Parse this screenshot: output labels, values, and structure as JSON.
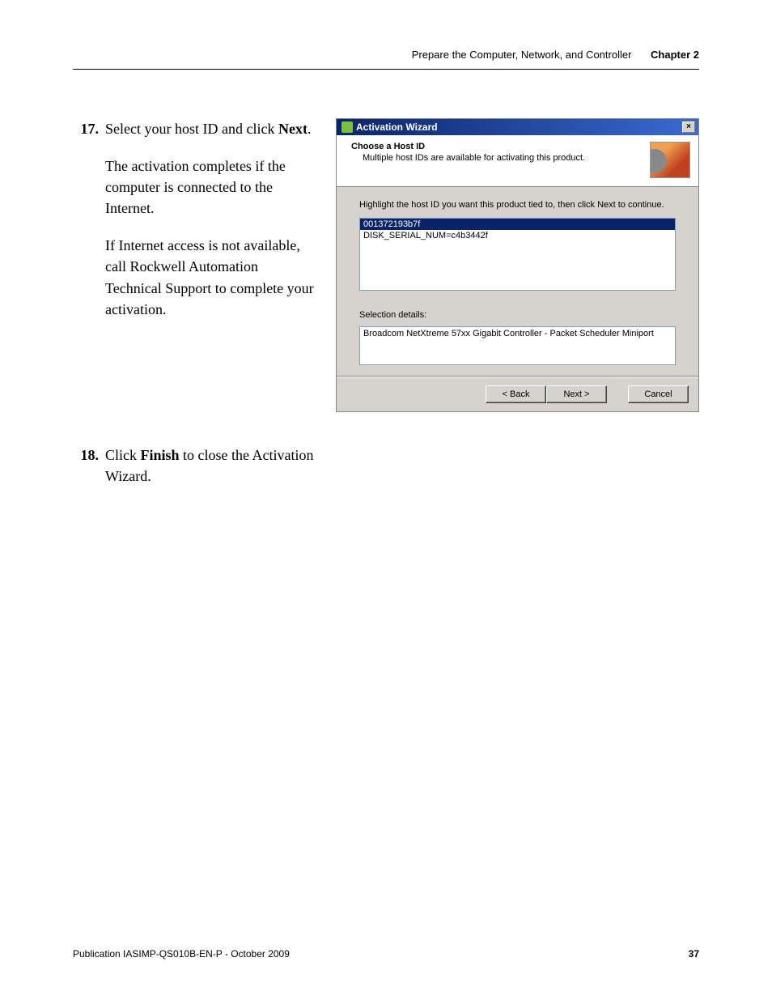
{
  "header": {
    "title": "Prepare the Computer, Network, and Controller",
    "chapter": "Chapter 2"
  },
  "step17": {
    "num": "17.",
    "line1a": "Select your host ID and click ",
    "line1b": "Next",
    "line1c": ".",
    "para2": "The activation completes if the computer is connected to the Internet.",
    "para3": "If Internet access is not available, call Rockwell Automation Technical Support to complete your activation."
  },
  "step18": {
    "num": "18.",
    "line1a": "Click ",
    "line1b": "Finish",
    "line1c": " to close the Activation Wizard."
  },
  "wizard": {
    "title": "Activation Wizard",
    "close": "×",
    "header_title": "Choose a Host ID",
    "header_sub": "Multiple host IDs are available for activating this product.",
    "instruction": "Highlight the host ID you want this product tied to, then click Next to continue.",
    "host_ids": {
      "item0": "001372193b7f",
      "item1": "DISK_SERIAL_NUM=c4b3442f"
    },
    "selection_label": "Selection details:",
    "selection_details": "Broadcom NetXtreme 57xx Gigabit Controller - Packet Scheduler Miniport",
    "buttons": {
      "back": "< Back",
      "next": "Next >",
      "cancel": "Cancel"
    }
  },
  "footer": {
    "publication": "Publication IASIMP-QS010B-EN-P - October 2009",
    "page": "37"
  }
}
